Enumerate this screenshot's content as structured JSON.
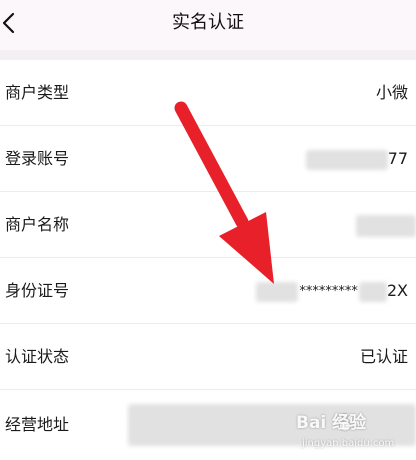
{
  "header": {
    "title": "实名认证"
  },
  "rows": [
    {
      "label": "商户类型",
      "value": "小微"
    },
    {
      "label": "登录账号",
      "value_suffix": "77"
    },
    {
      "label": "商户名称"
    },
    {
      "label": "身份证号",
      "masked": "*********",
      "value_suffix": "2X"
    },
    {
      "label": "认证状态",
      "value": "已认证"
    },
    {
      "label": "经营地址"
    }
  ],
  "watermark": {
    "brand": "Bai 经验",
    "url": "jingyan.baidu.com"
  },
  "colors": {
    "arrow": "#e8202a",
    "header_bg": "#fbf7fb",
    "separator": "#ececec"
  }
}
